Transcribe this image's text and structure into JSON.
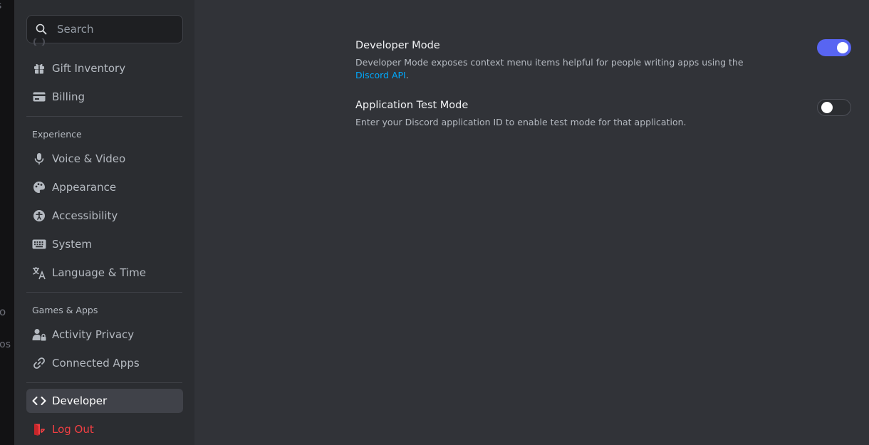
{
  "background_fragments": [
    "s",
    "o",
    "cros"
  ],
  "search": {
    "placeholder": "Search"
  },
  "sidebar": {
    "billing_items": [
      {
        "label": "Gift Inventory",
        "icon": "gift-icon"
      },
      {
        "label": "Billing",
        "icon": "credit-card-icon"
      }
    ],
    "experience_header": "Experience",
    "experience_items": [
      {
        "label": "Voice & Video",
        "icon": "microphone-icon"
      },
      {
        "label": "Appearance",
        "icon": "palette-icon"
      },
      {
        "label": "Accessibility",
        "icon": "accessibility-icon"
      },
      {
        "label": "System",
        "icon": "keyboard-icon"
      },
      {
        "label": "Language & Time",
        "icon": "translate-icon"
      }
    ],
    "games_header": "Games & Apps",
    "games_items": [
      {
        "label": "Activity Privacy",
        "icon": "activity-privacy-icon"
      },
      {
        "label": "Connected Apps",
        "icon": "link-icon"
      }
    ],
    "developer": {
      "label": "Developer",
      "icon": "code-icon",
      "active": true
    },
    "logout": {
      "label": "Log Out",
      "icon": "logout-icon"
    }
  },
  "settings": {
    "developer_mode": {
      "title": "Developer Mode",
      "description": "Developer Mode exposes context menu items helpful for people writing apps using the ",
      "link_text": "Discord API",
      "description_end": ".",
      "enabled": true
    },
    "app_test_mode": {
      "title": "Application Test Mode",
      "description": "Enter your Discord application ID to enable test mode for that application.",
      "enabled": false
    }
  },
  "colors": {
    "accent": "#5865f2",
    "link": "#00a8fc",
    "danger": "#f23f43",
    "sidebar_bg": "#2b2d31",
    "content_bg": "#313338"
  }
}
